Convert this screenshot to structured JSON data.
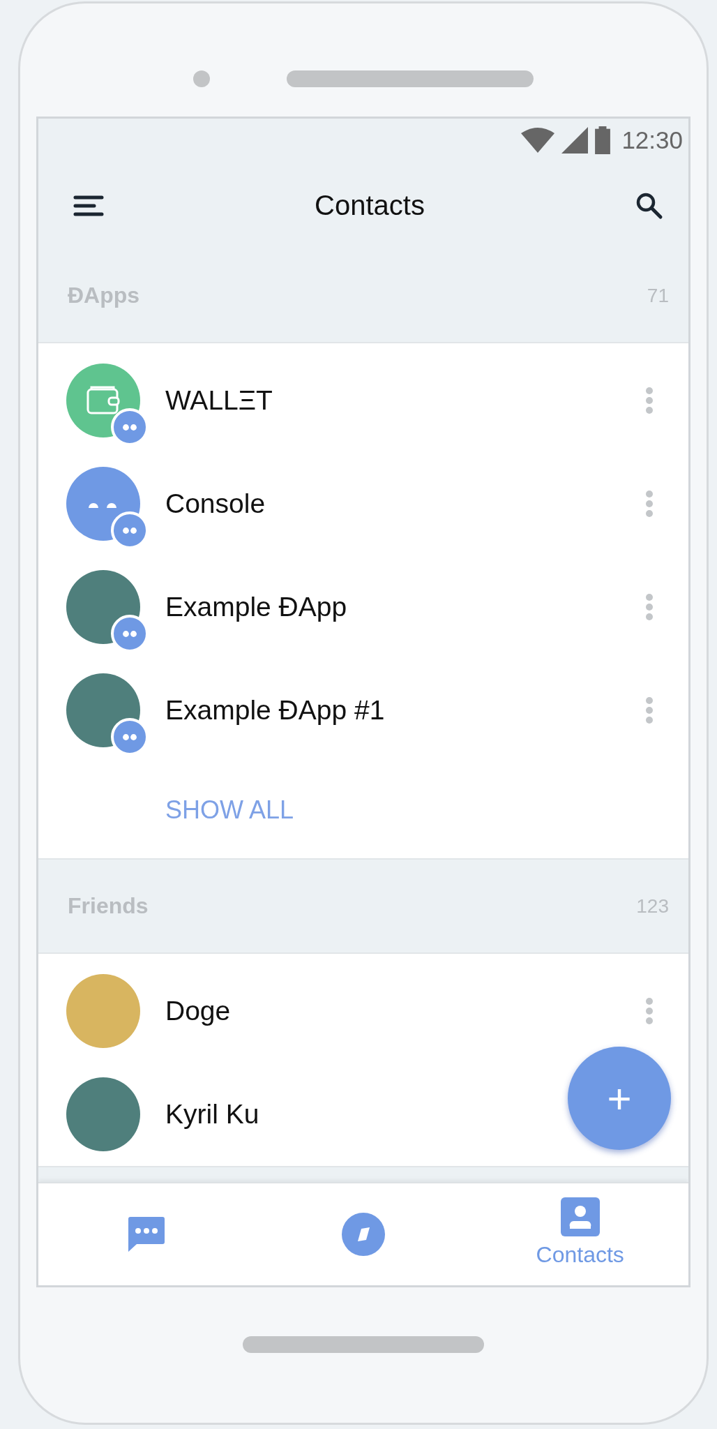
{
  "status_bar": {
    "time": "12:30"
  },
  "toolbar": {
    "title": "Contacts"
  },
  "sections": [
    {
      "title": "ĐApps",
      "count": "71",
      "contacts": [
        {
          "name": "WALLΞT",
          "kind": "wallet",
          "dapp_badge": true,
          "more_menu": true
        },
        {
          "name": "Console",
          "kind": "console",
          "dapp_badge": true,
          "more_menu": true
        },
        {
          "name": "Example ĐApp",
          "kind": "photo",
          "dapp_badge": true,
          "more_menu": true
        },
        {
          "name": "Example ĐApp #1",
          "kind": "photo",
          "dapp_badge": true,
          "more_menu": true
        }
      ],
      "show_all": "SHOW ALL"
    },
    {
      "title": "Friends",
      "count": "123",
      "contacts": [
        {
          "name": "Doge",
          "kind": "dog",
          "dapp_badge": false,
          "more_menu": true
        },
        {
          "name": "Kyril Ku",
          "kind": "photo",
          "dapp_badge": false,
          "more_menu": false
        }
      ]
    }
  ],
  "fab": {
    "label": "+"
  },
  "bottom_nav": [
    {
      "kind": "chats",
      "selected": false
    },
    {
      "kind": "discover",
      "selected": false
    },
    {
      "kind": "contacts",
      "label": "Contacts",
      "selected": true
    }
  ]
}
